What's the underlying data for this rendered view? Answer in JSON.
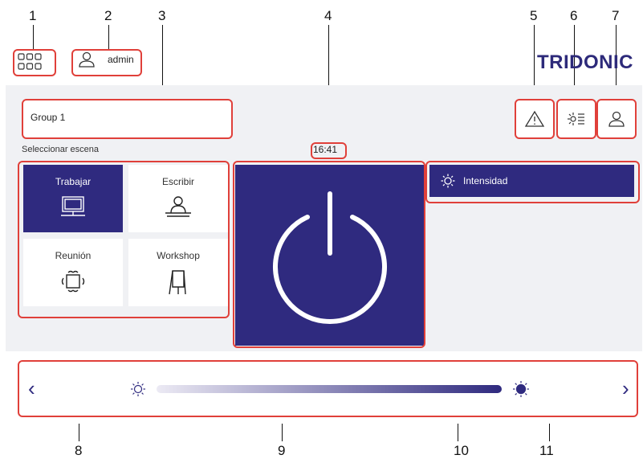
{
  "header": {
    "user_label": "admin",
    "brand": "TRIDONIC"
  },
  "group": {
    "name": "Group 1"
  },
  "scenes": {
    "title": "Seleccionar escena",
    "items": [
      {
        "label": "Trabajar",
        "icon": "monitor-icon",
        "active": true
      },
      {
        "label": "Escribir",
        "icon": "desk-person-icon",
        "active": false
      },
      {
        "label": "Reunión",
        "icon": "meeting-table-icon",
        "active": false
      },
      {
        "label": "Workshop",
        "icon": "flipchart-icon",
        "active": false
      }
    ]
  },
  "clock": "16:41",
  "intensity": {
    "label": "Intensidad"
  },
  "callouts": [
    "1",
    "2",
    "3",
    "4",
    "5",
    "6",
    "7",
    "8",
    "9",
    "10",
    "11"
  ],
  "colors": {
    "brand": "#2d2a7a",
    "accent": "#2f2a7f",
    "callout": "#e0403a",
    "panel": "#f0f1f4"
  }
}
